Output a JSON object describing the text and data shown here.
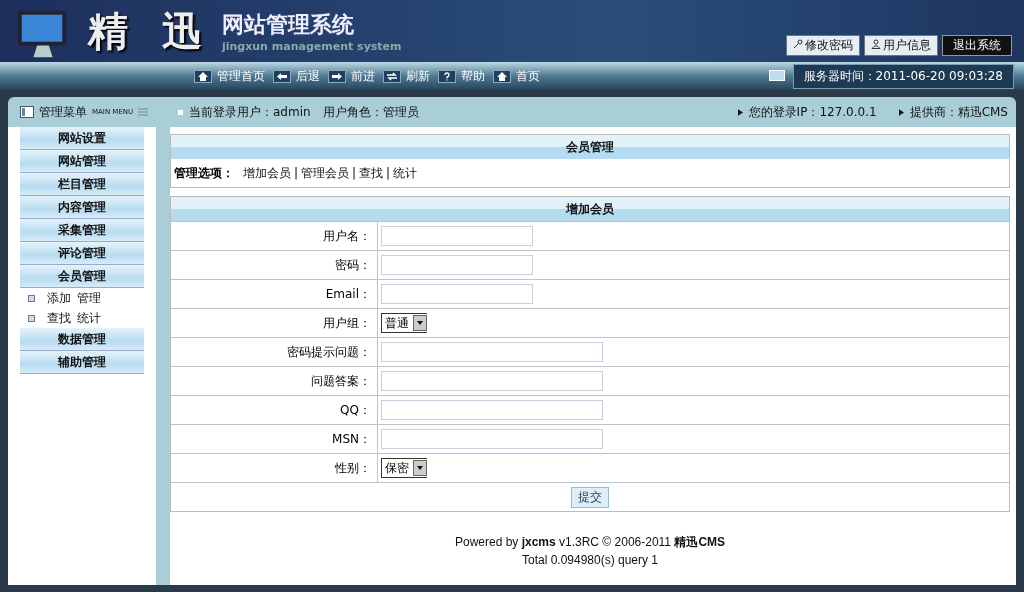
{
  "header": {
    "logo_title": "精 迅",
    "logo_subtitle": "网站管理系统",
    "logo_tagline": "jingxun management system",
    "top_buttons": [
      {
        "label": "修改密码",
        "kind": "key"
      },
      {
        "label": "用户信息",
        "kind": "user"
      },
      {
        "label": "退出系统",
        "kind": "dark"
      }
    ],
    "nav": [
      {
        "label": "管理首页",
        "kind": "home"
      },
      {
        "label": "后退",
        "kind": "back"
      },
      {
        "label": "前进",
        "kind": "forward"
      },
      {
        "label": "刷新",
        "kind": "refresh"
      },
      {
        "label": "帮助",
        "kind": "help"
      },
      {
        "label": "首页",
        "kind": "home"
      }
    ],
    "server_time": "服务器时间：2011-06-20 09:03:28"
  },
  "sidebar": {
    "title": "管理菜单",
    "subtitle": "MAIN MENU",
    "items": [
      {
        "label": "网站设置"
      },
      {
        "label": "网站管理"
      },
      {
        "label": "栏目管理"
      },
      {
        "label": "内容管理"
      },
      {
        "label": "采集管理"
      },
      {
        "label": "评论管理"
      },
      {
        "label": "会员管理",
        "children": [
          {
            "links": [
              "添加",
              "管理"
            ]
          },
          {
            "links": [
              "查找",
              "统计"
            ]
          }
        ]
      },
      {
        "label": "数据管理"
      },
      {
        "label": "辅助管理"
      }
    ]
  },
  "info_bar": {
    "user": "当前登录用户：admin　用户角色：管理员",
    "ip": "您的登录IP：127.0.0.1",
    "provider": "提供商：精迅CMS"
  },
  "member_panel": {
    "title": "会员管理",
    "options_label": "管理选项：",
    "options": [
      "增加会员",
      "管理会员",
      "查找",
      "统计"
    ],
    "separator": "|"
  },
  "form": {
    "title": "增加会员",
    "fields": [
      {
        "label": "用户名：",
        "kind": "short"
      },
      {
        "label": "密码：",
        "kind": "short"
      },
      {
        "label": "Email：",
        "kind": "short"
      },
      {
        "label": "用户组：",
        "kind": "select",
        "value": "普通"
      },
      {
        "label": "密码提示问题：",
        "kind": "long"
      },
      {
        "label": "问题答案：",
        "kind": "long"
      },
      {
        "label": "QQ：",
        "kind": "long"
      },
      {
        "label": "MSN：",
        "kind": "long"
      },
      {
        "label": "性别：",
        "kind": "select",
        "value": "保密"
      }
    ],
    "submit": "提交"
  },
  "footer": {
    "powered": "Powered by **jxcms** v1.3RC  © 2006-2011 **精迅CMS**",
    "total": "Total 0.094980(s) query 1"
  }
}
